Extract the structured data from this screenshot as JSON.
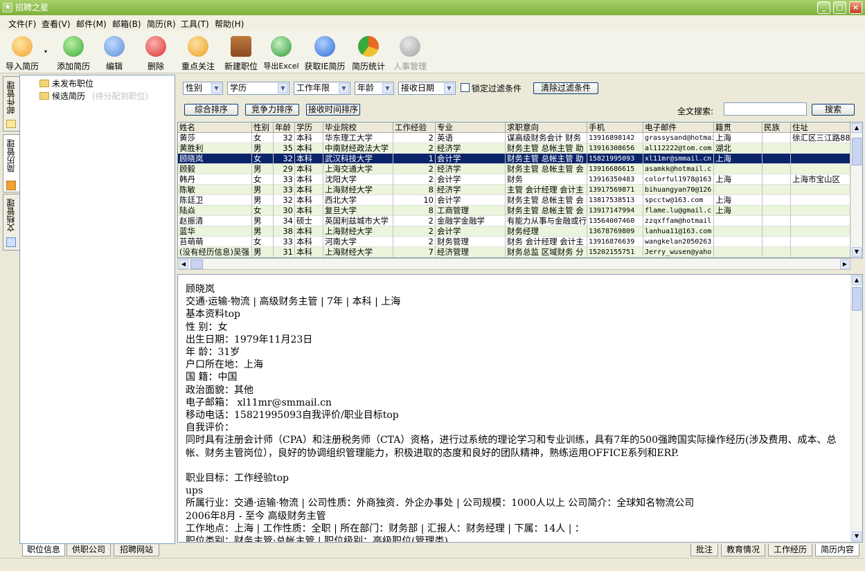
{
  "window": {
    "title": "招聘之星",
    "minimize": "_",
    "maximize": "□",
    "close": "×"
  },
  "menu": [
    "文件(F)",
    "查看(V)",
    "邮件(M)",
    "邮箱(B)",
    "简历(R)",
    "工具(T)",
    "帮助(H)"
  ],
  "toolbar": [
    {
      "label": "导入简历",
      "icon": "import-resume-icon",
      "color": "#f0a030"
    },
    {
      "label": "添加简历",
      "icon": "add-resume-icon",
      "color": "#3aa83a"
    },
    {
      "label": "编辑",
      "icon": "edit-icon",
      "color": "#5a8fd8"
    },
    {
      "label": "删除",
      "icon": "delete-icon",
      "color": "#d83030"
    },
    {
      "label": "重点关注",
      "icon": "focus-icon",
      "color": "#e8a020"
    },
    {
      "label": "新建职位",
      "icon": "briefcase-icon",
      "color": "#8a4a20"
    },
    {
      "label": "导出Excel",
      "icon": "excel-icon",
      "color": "#2a9a3a"
    },
    {
      "label": "获取IE简历",
      "icon": "ie-icon",
      "color": "#2a6ad8"
    },
    {
      "label": "简历统计",
      "icon": "chart-icon",
      "color": "#e86a20"
    },
    {
      "label": "人事管理",
      "icon": "hr-icon",
      "color": "#a0a0a0"
    }
  ],
  "left_tabs": [
    "邮件管理",
    "简历管理",
    "文档管理"
  ],
  "tree": {
    "unpublished": "未发布职位",
    "candidates": "候选简历",
    "candidates_hint": "(待分配到职位)"
  },
  "left_bottom_tabs": [
    "职位信息",
    "供职公司",
    "招聘网站"
  ],
  "filters": {
    "gender": "性别",
    "education": "学历",
    "experience": "工作年限",
    "age": "年龄",
    "date": "接收日期",
    "lock_label": "锁定过滤条件",
    "clear_button": "清除过滤条件",
    "sort_composite": "综合排序",
    "sort_competitiveness": "竞争力排序",
    "sort_time": "接收时间排序",
    "search_label": "全文搜索:",
    "search_value": "",
    "search_button": "搜索"
  },
  "grid": {
    "columns": [
      "姓名",
      "性别",
      "年龄",
      "学历",
      "毕业院校",
      "工作经验",
      "专业",
      "求职意向",
      "手机",
      "电子邮件",
      "籍贯",
      "民族",
      "住址"
    ],
    "rows": [
      [
        "黄莎",
        "女",
        "32",
        "本科",
        "华东理工大学",
        "2",
        "英语",
        "谋高级财务会计 财务",
        "13916898142",
        "grassysand@hotmai",
        "上海",
        "",
        "徐汇区三江路88"
      ],
      [
        "黄胜利",
        "男",
        "35",
        "本科",
        "中南财经政法大学",
        "2",
        "经济学",
        "财务主管 总帐主管 助",
        "13916308656",
        "al112222@tom.com",
        "湖北",
        "",
        ""
      ],
      [
        "顾晓岚",
        "女",
        "32",
        "本科",
        "武汉科技大学",
        "1",
        "会计学",
        "财务主管 总帐主管 助",
        "15821995093",
        "xl11mr@smmail.cn",
        "上海",
        "",
        ""
      ],
      [
        "顾毅",
        "男",
        "29",
        "本科",
        "上海交通大学",
        "2",
        "经济学",
        "财务主管 总帐主管 会",
        "13916686615",
        "asamkk@hotmail.c",
        "",
        "",
        ""
      ],
      [
        "韩丹",
        "女",
        "33",
        "本科",
        "沈阳大学",
        "2",
        "会计学",
        "财务",
        "13916350483",
        "colorful1978@163.",
        "上海",
        "",
        "上海市宝山区"
      ],
      [
        "陈敏",
        "男",
        "33",
        "本科",
        "上海财经大学",
        "8",
        "经济学",
        "主管 会计经理 会计主",
        "13917569871",
        "bihuangyan70@126.",
        "",
        "",
        ""
      ],
      [
        "陈廷卫",
        "男",
        "32",
        "本科",
        "西北大学",
        "10",
        "会计学",
        "财务主管 总帐主管 会",
        "13817538513",
        "spcctw@163.com",
        "上海",
        "",
        ""
      ],
      [
        "陆焱",
        "女",
        "30",
        "本科",
        "复旦大学",
        "8",
        "工商管理",
        "财务主管 总帐主管 会",
        "13917147994",
        "flame.lu@gmail.c",
        "上海",
        "",
        ""
      ],
      [
        "赵振清",
        "男",
        "34",
        "硕士",
        "英国利兹城市大学",
        "2",
        "金融学金融学",
        "有能力从事与金融或行",
        "13564007460",
        "zzqxffam@hotmail.",
        "",
        "",
        ""
      ],
      [
        "蓝华",
        "男",
        "38",
        "本科",
        "上海财经大学",
        "2",
        "会计学",
        "财务经理",
        "13678769809",
        "lanhua11@163.com",
        "",
        "",
        ""
      ],
      [
        "苔萌萌",
        "女",
        "33",
        "本科",
        "河南大学",
        "2",
        "财务管理",
        "财务 会计经理 会计主",
        "13916876639",
        "wangkelan2050263.",
        "",
        "",
        ""
      ],
      [
        "(没有经历信息)吴强",
        "男",
        "31",
        "本科",
        "上海财经大学",
        "7",
        "经济管理",
        "财务总监 区域财务 分",
        "15202155751",
        "Jerry_wusen@yaho",
        "",
        "",
        ""
      ]
    ],
    "selected_index": 2
  },
  "detail": {
    "lines": [
      "顾晓岚",
      "交通·运输·物流 | 高级财务主管 | 7年 | 本科 | 上海",
      "基本资料top",
      "性 别：女",
      "出生日期：1979年11月23日",
      "年 龄：31岁",
      "户口所在地：上海",
      "国 籍：中国",
      "政治面貌：其他",
      "电子邮箱： xl11mr@smmail.cn",
      "移动电话：15821995093自我评价/职业目标top",
      "自我评价：",
      "同时具有注册会计师（CPA）和注册税务师（CTA）资格，进行过系统的理论学习和专业训练，具有7年的500强跨国实际操作经历(涉及费用、成本、总帐、财务主管岗位），良好的协调组织管理能力，积极进取的态度和良好的团队精神，熟练运用OFFICE系列和ERP.",
      "",
      "职业目标：工作经验top",
      "ups",
      "所属行业：交通·运输·物流 | 公司性质：外商独资．外企办事处 | 公司规模：1000人以上 公司简介：全球知名物流公司",
      "2006年8月 - 至今 高级财务主管",
      "工作地点：上海 | 工作性质：全职 | 所在部门：财务部 | 汇报人：财务经理 | 下属：14人 | ：",
      "职位类别：财务主管·总帐主管 | 职位级别：高级职位(管理类)"
    ]
  },
  "right_bottom_tabs": [
    "批注",
    "教育情况",
    "工作经历",
    "简历内容"
  ],
  "colors": {
    "selected_row": "#0a246a",
    "alt_row": "#eaf5dc",
    "title_green": "#8cc24a"
  }
}
